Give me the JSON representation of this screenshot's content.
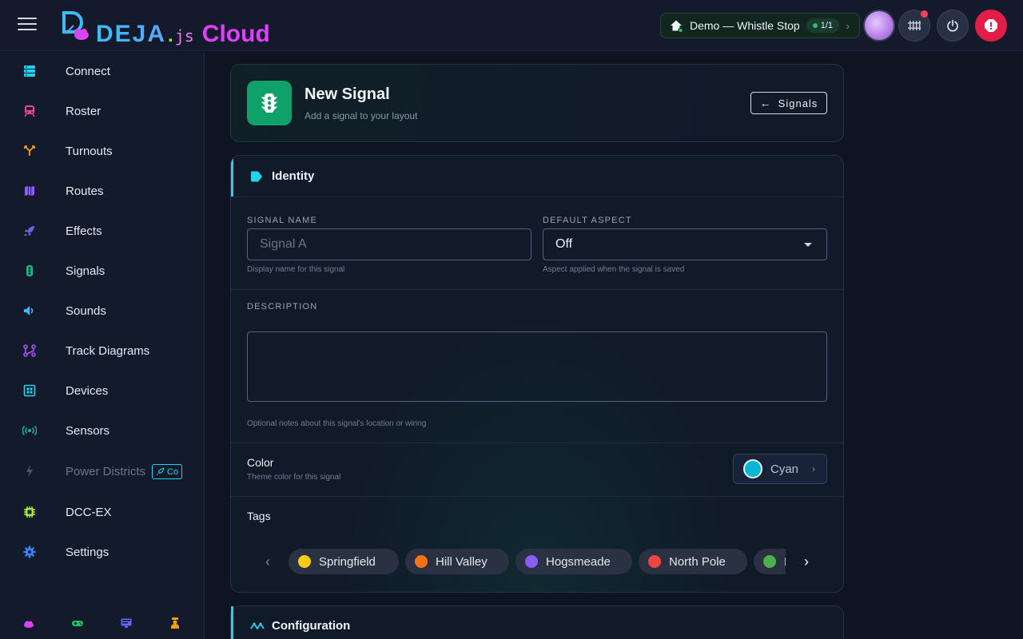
{
  "app": {
    "logo_deja": "DEJA",
    "logo_dot": ".",
    "logo_js": "js",
    "logo_cloud": "Cloud"
  },
  "topbar": {
    "layout_label": "Demo — Whistle Stop",
    "layout_count": "1/1",
    "chevron": "›"
  },
  "sidebar": {
    "items": [
      {
        "label": "Connect",
        "icon": "server-icon",
        "color": "#22d3ee"
      },
      {
        "label": "Roster",
        "icon": "train-icon",
        "color": "#ec4899"
      },
      {
        "label": "Turnouts",
        "icon": "call-split-icon",
        "color": "#f59e0b"
      },
      {
        "label": "Routes",
        "icon": "map-icon",
        "color": "#8b5cf6"
      },
      {
        "label": "Effects",
        "icon": "rocket-icon",
        "color": "#6366f1"
      },
      {
        "label": "Signals",
        "icon": "traffic-light-icon",
        "color": "#10b981"
      },
      {
        "label": "Sounds",
        "icon": "volume-icon",
        "color": "#38bdf8"
      },
      {
        "label": "Track Diagrams",
        "icon": "diagram-icon",
        "color": "#a855f7"
      },
      {
        "label": "Devices",
        "icon": "chip-board-icon",
        "color": "#22d3ee"
      },
      {
        "label": "Sensors",
        "icon": "broadcast-icon",
        "color": "#14b8a6"
      },
      {
        "label": "Power Districts",
        "icon": "lightning-icon",
        "color": "#4b5563",
        "badge": "Co"
      },
      {
        "label": "DCC-EX",
        "icon": "cpu-icon",
        "color": "#a3e635"
      },
      {
        "label": "Settings",
        "icon": "gear-icon",
        "color": "#3b82f6"
      }
    ]
  },
  "header": {
    "title": "New Signal",
    "subtitle": "Add a signal to your layout",
    "back_label": "Signals"
  },
  "identity": {
    "title": "Identity",
    "signal_name_label": "SIGNAL NAME",
    "signal_name_placeholder": "Signal A",
    "signal_name_value": "",
    "signal_name_hint": "Display name for this signal",
    "default_aspect_label": "DEFAULT ASPECT",
    "default_aspect_value": "Off",
    "default_aspect_hint": "Aspect applied when the signal is saved",
    "description_label": "DESCRIPTION",
    "description_value": "",
    "description_hint": "Optional notes about this signal's location or wiring",
    "color_title": "Color",
    "color_subtitle": "Theme color for this signal",
    "color_value": "Cyan",
    "color_hex": "#06b6d4",
    "tags_title": "Tags",
    "tags": [
      {
        "label": "Springfield",
        "color": "#facc15"
      },
      {
        "label": "Hill Valley",
        "color": "#f97316"
      },
      {
        "label": "Hogsmeade",
        "color": "#8b5cf6"
      },
      {
        "label": "North Pole",
        "color": "#ef4444"
      },
      {
        "label": "K",
        "color": "#4caf50"
      }
    ]
  },
  "configuration": {
    "title": "Configuration"
  }
}
